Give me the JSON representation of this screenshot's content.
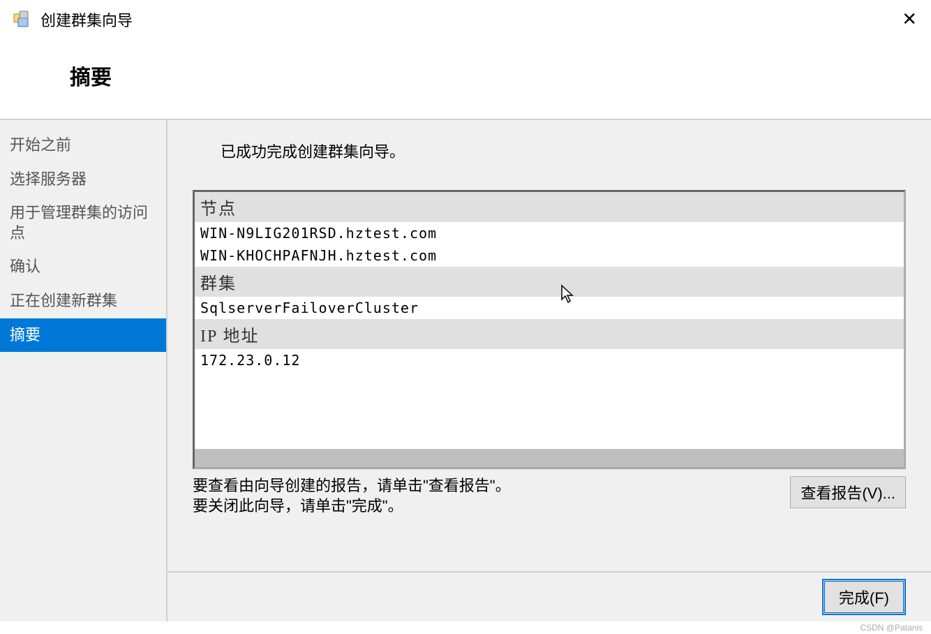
{
  "titlebar": {
    "title": "创建群集向导"
  },
  "page_heading": "摘要",
  "sidebar": {
    "items": [
      {
        "label": "开始之前"
      },
      {
        "label": "选择服务器"
      },
      {
        "label": "用于管理群集的访问点"
      },
      {
        "label": "确认"
      },
      {
        "label": "正在创建新群集"
      },
      {
        "label": "摘要"
      }
    ],
    "active_index": 5
  },
  "main": {
    "success_message": "已成功完成创建群集向导。",
    "report": {
      "sections": [
        {
          "header": "节点",
          "values": [
            "WIN-N9LIG201RSD.hztest.com",
            "WIN-KHOCHPAFNJH.hztest.com"
          ]
        },
        {
          "header": "群集",
          "values": [
            "SqlserverFailoverCluster"
          ]
        },
        {
          "header": "IP 地址",
          "values": [
            "172.23.0.12"
          ]
        }
      ]
    },
    "hint_line1": "要查看由向导创建的报告，请单击\"查看报告\"。",
    "hint_line2": "要关闭此向导，请单击\"完成\"。",
    "view_report_label": "查看报告(V)...",
    "finish_label": "完成(F)"
  },
  "watermark": "CSDN @Patanis"
}
